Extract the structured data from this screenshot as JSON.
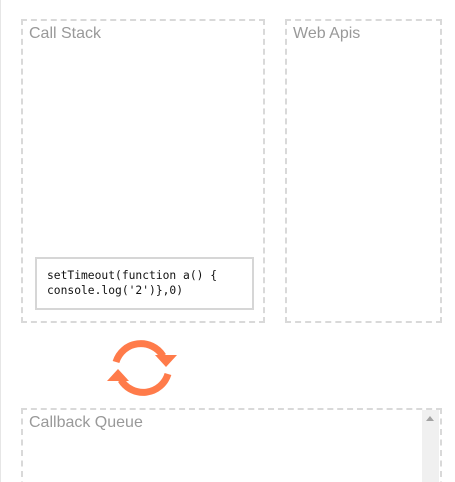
{
  "call_stack": {
    "title": "Call Stack",
    "frames": [
      {
        "line1": "setTimeout(function a() {",
        "line2": "console.log('2')},0)"
      }
    ]
  },
  "web_apis": {
    "title": "Web Apis"
  },
  "event_loop": {
    "icon": "refresh-icon",
    "color": "#ff7b4a"
  },
  "callback_queue": {
    "title": "Callback Queue"
  }
}
